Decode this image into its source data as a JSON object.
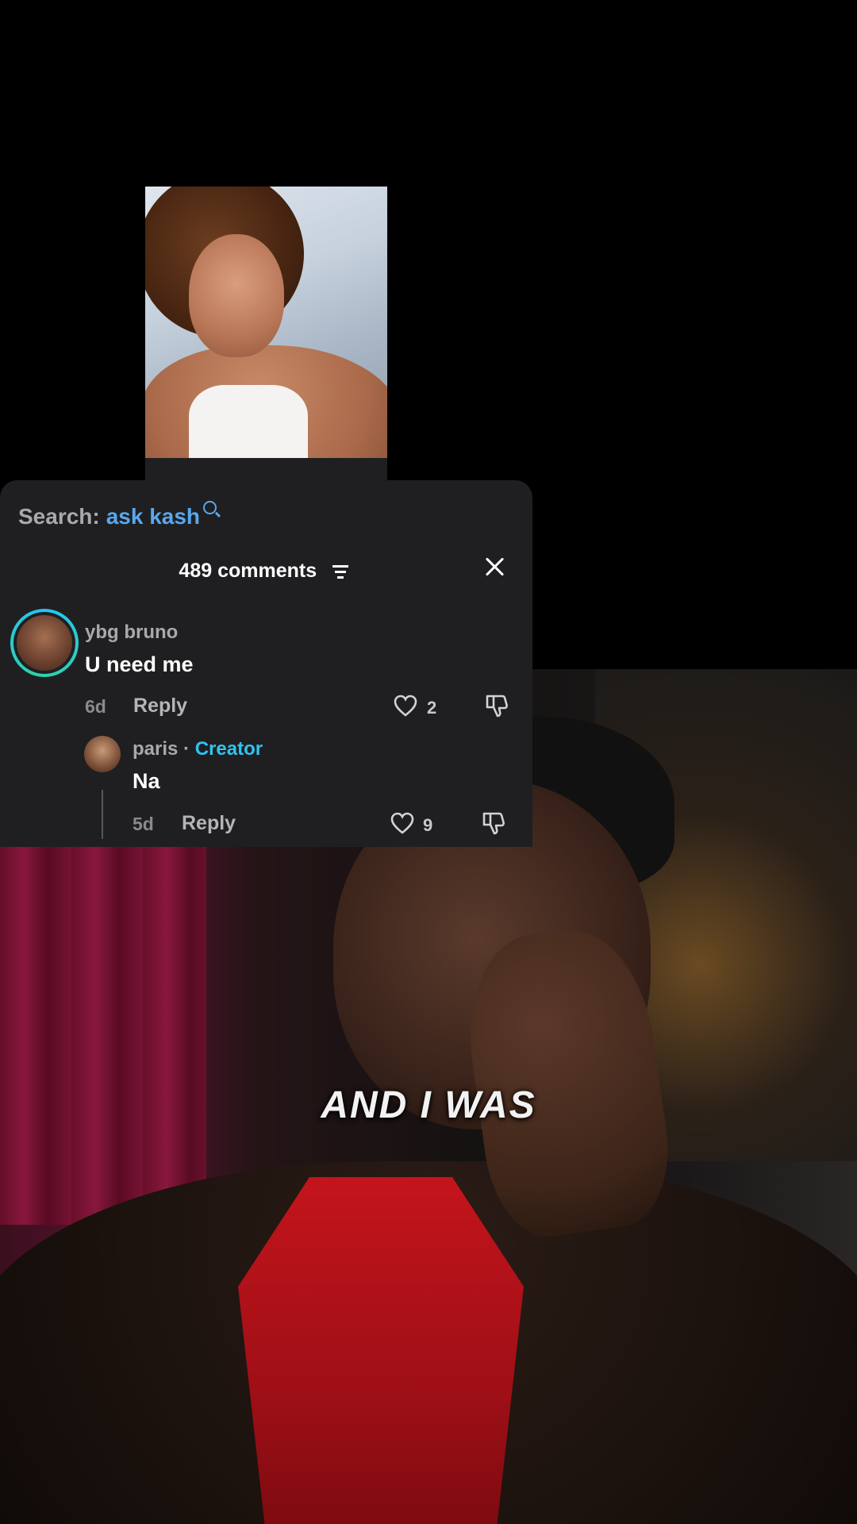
{
  "search": {
    "label": "Search:",
    "query": "ask kash"
  },
  "comments_header": {
    "count_label": "489 comments"
  },
  "comments": [
    {
      "username": "ybg bruno",
      "text": "U need me",
      "age": "6d",
      "reply_label": "Reply",
      "likes": "2"
    },
    {
      "username": "paris",
      "separator": "·",
      "badge": "Creator",
      "text": "Na",
      "age": "5d",
      "reply_label": "Reply",
      "likes": "9"
    }
  ],
  "video": {
    "caption": "AND I WAS"
  },
  "colors": {
    "accent_blue": "#59a7ee",
    "creator_cyan": "#2ec4f0",
    "panel_bg": "#1f1f21"
  },
  "icons": [
    "search-icon",
    "filter-icon",
    "close-icon",
    "heart-icon",
    "dislike-icon"
  ]
}
